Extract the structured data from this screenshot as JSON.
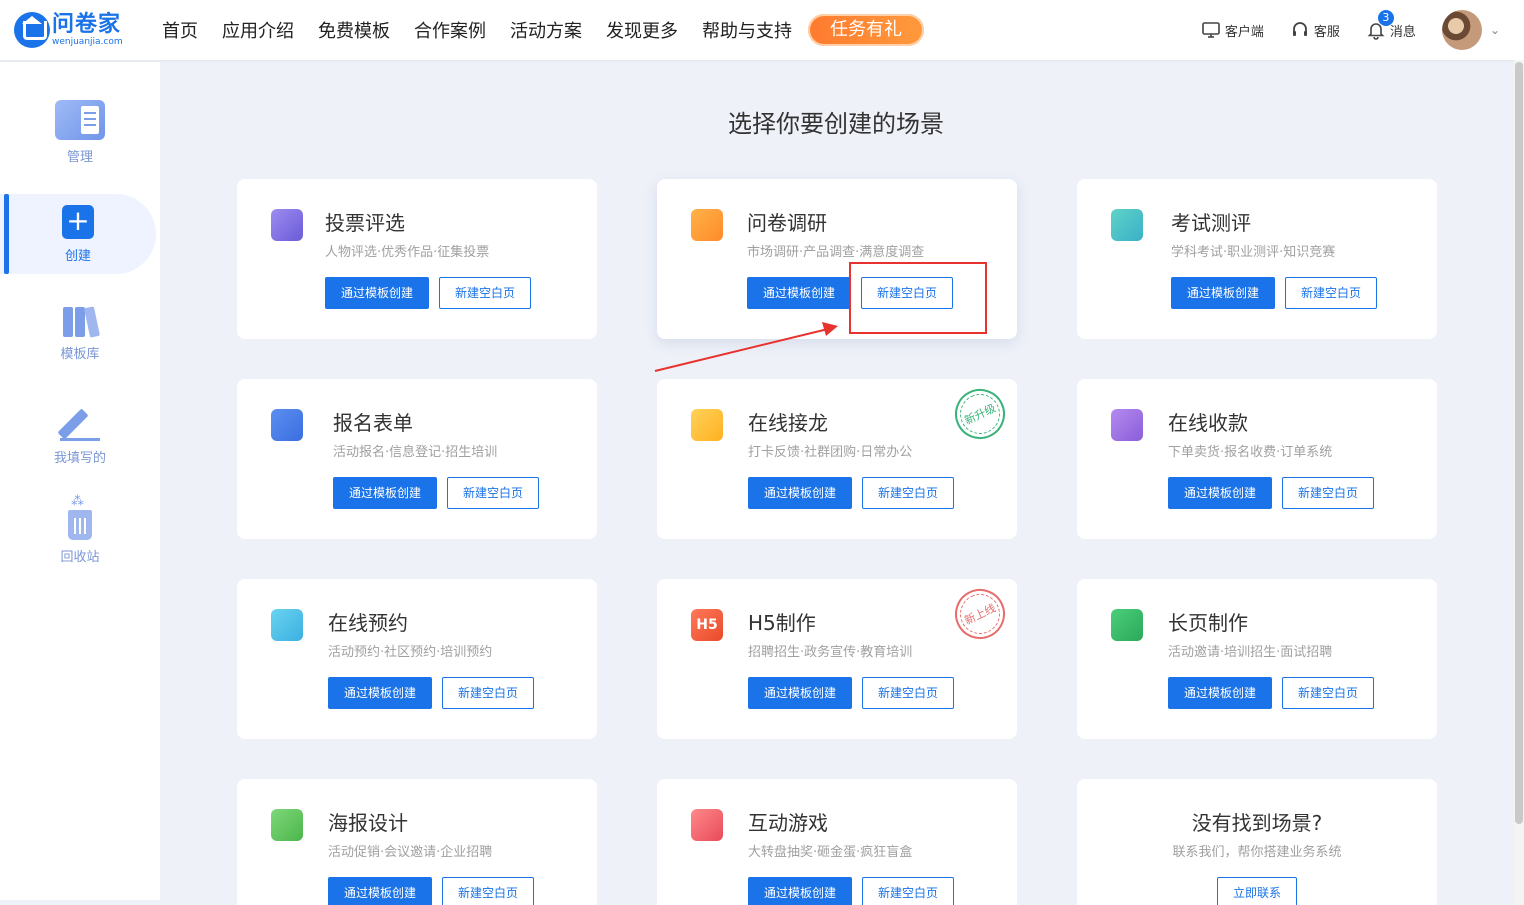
{
  "header": {
    "logo_cn": "问卷家",
    "logo_en": "wenjuanjia.com",
    "nav": [
      "首页",
      "应用介绍",
      "免费模板",
      "合作案例",
      "活动方案",
      "发现更多",
      "帮助与支持"
    ],
    "promo": "任务有礼",
    "tools": {
      "client": "客户端",
      "service": "客服",
      "messages": "消息",
      "message_count": "3"
    }
  },
  "sidebar": {
    "items": [
      {
        "label": "管理"
      },
      {
        "label": "创建"
      },
      {
        "label": "模板库"
      },
      {
        "label": "我填写的"
      },
      {
        "label": "回收站"
      }
    ]
  },
  "main": {
    "title": "选择你要创建的场景",
    "btn_template": "通过模板创建",
    "btn_blank": "新建空白页",
    "cards": [
      {
        "title": "投票评选",
        "sub": "人物评选·优秀作品·征集投票"
      },
      {
        "title": "问卷调研",
        "sub": "市场调研·产品调查·满意度调查"
      },
      {
        "title": "考试测评",
        "sub": "学科考试·职业测评·知识竞赛"
      },
      {
        "title": "报名表单",
        "sub": "活动报名·信息登记·招生培训"
      },
      {
        "title": "在线接龙",
        "sub": "打卡反馈·社群团购·日常办公",
        "stamp": "新升级"
      },
      {
        "title": "在线收款",
        "sub": "下单卖货·报名收费·订单系统"
      },
      {
        "title": "在线预约",
        "sub": "活动预约·社区预约·培训预约"
      },
      {
        "title": "H5制作",
        "sub": "招聘招生·政务宣传·教育培训",
        "stamp": "新上线",
        "icon_text": "H5"
      },
      {
        "title": "长页制作",
        "sub": "活动邀请·培训招生·面试招聘"
      },
      {
        "title": "海报设计",
        "sub": "活动促销·会议邀请·企业招聘"
      },
      {
        "title": "互动游戏",
        "sub": "大转盘抽奖·砸金蛋·疯狂盲盒"
      }
    ],
    "contact": {
      "title": "没有找到场景?",
      "sub": "联系我们，帮你搭建业务系统",
      "button": "立即联系"
    }
  }
}
